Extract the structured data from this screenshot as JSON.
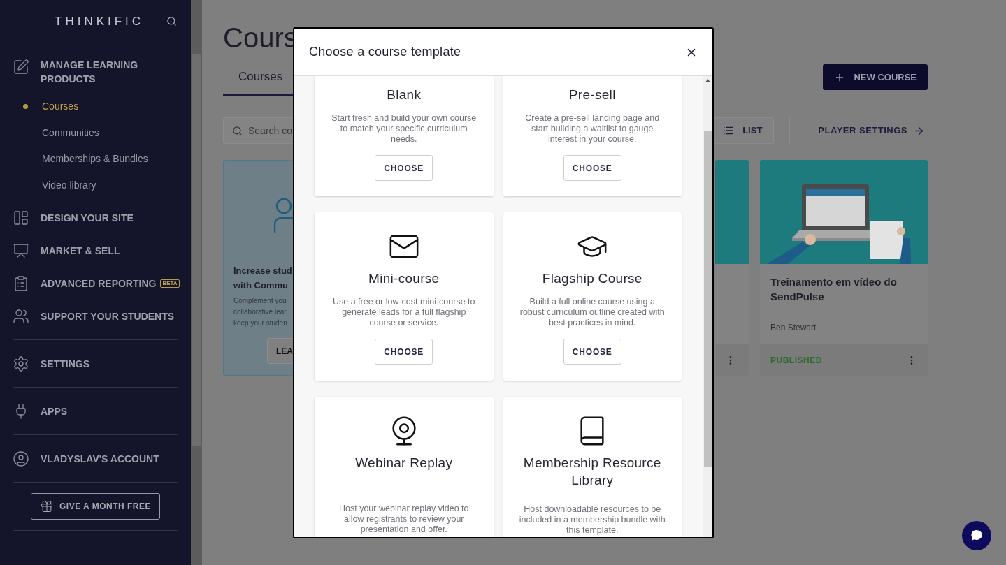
{
  "sidebar": {
    "logo": "THINKIFIC",
    "sections": [
      [
        {
          "label": "MANAGE LEARNING PRODUCTS",
          "children": [
            {
              "label": "Courses",
              "selected": true
            },
            {
              "label": "Communities",
              "selected": false
            },
            {
              "label": "Memberships & Bundles",
              "selected": false
            },
            {
              "label": "Video library",
              "selected": false
            }
          ]
        },
        {
          "label": "DESIGN YOUR SITE"
        },
        {
          "label": "MARKET & SELL"
        },
        {
          "label": "ADVANCED REPORTING",
          "badge": "BETA"
        },
        {
          "label": "SUPPORT YOUR STUDENTS"
        }
      ],
      [
        {
          "label": "SETTINGS"
        }
      ],
      [
        {
          "label": "APPS"
        }
      ],
      [
        {
          "label": "VLADYSLAV'S ACCOUNT"
        }
      ]
    ],
    "gift_button": "GIVE A MONTH FREE"
  },
  "main": {
    "title": "Cours",
    "tabs": [
      {
        "label": "Courses",
        "selected": true
      }
    ],
    "new_course_button": "NEW COURSE",
    "search": {
      "placeholder": "Search co"
    },
    "view_buttons": [
      {
        "label": "LIST",
        "selected": false
      }
    ],
    "player_settings": "PLAYER SETTINGS",
    "promo": {
      "title_lines": [
        "Increase stud",
        "with Commu"
      ],
      "body_lines": [
        "Complement you",
        "collaborative lear",
        "keep your studen"
      ],
      "button": "LEA"
    },
    "courses": [
      {
        "title": "Treinamento em vídeo do SendPulse",
        "author": "Ben Stewart",
        "status": "PUBLISHED"
      }
    ]
  },
  "modal": {
    "title": "Choose a course template",
    "templates": [
      {
        "name": "Blank",
        "description": "Start fresh and build your own course to match your specific curriculum needs.",
        "button": "CHOOSE"
      },
      {
        "name": "Pre-sell",
        "description": "Create a pre-sell landing page and start building a waitlist to gauge interest in your course.",
        "button": "CHOOSE"
      },
      {
        "name": "Mini-course",
        "description": "Use a free or low-cost mini-course to generate leads for a full flagship course or service.",
        "button": "CHOOSE"
      },
      {
        "name": "Flagship Course",
        "description": "Build a full online course using a robust curriculum outline created with best practices in mind.",
        "button": "CHOOSE"
      },
      {
        "name": "Webinar Replay",
        "description": "Host your webinar replay video to allow registrants to review your presentation and offer."
      },
      {
        "name": "Membership Resource Library",
        "description": "Host downloadable resources to be included in a membership bundle with this template."
      }
    ]
  }
}
